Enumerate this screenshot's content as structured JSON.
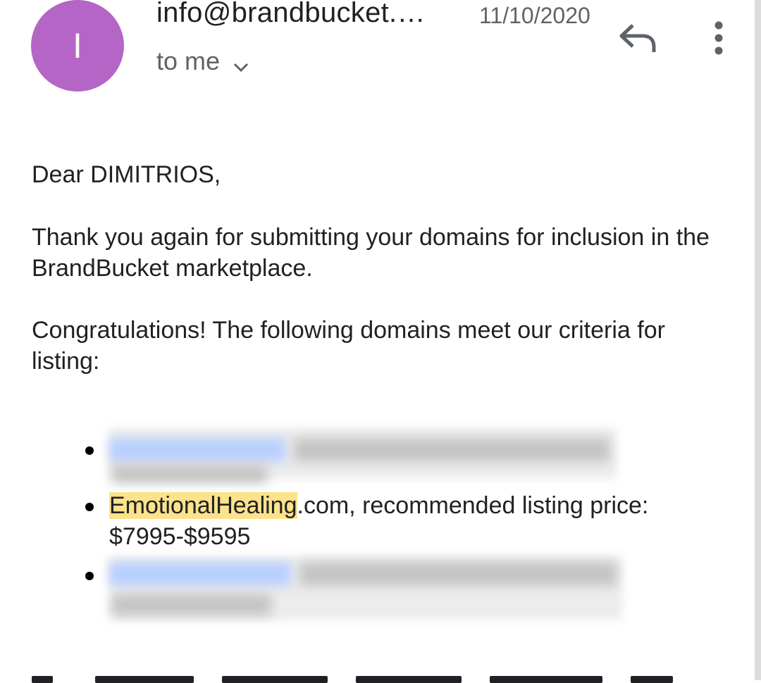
{
  "header": {
    "avatar_letter": "I",
    "sender": "info@brandbucket.…",
    "date": "11/10/2020",
    "recipient": "to me",
    "accent_color": "#b565c6"
  },
  "icons": {
    "reply": "reply-arrow-icon",
    "more": "vertical-dots-icon",
    "expand": "chevron-down-icon"
  },
  "email": {
    "greeting": "Dear DIMITRIOS,",
    "thanks": "Thank you again for submitting your domains for inclusion in the BrandBucket marketplace.",
    "congrats": "Congratulations! The following domains meet our criteria for listing:",
    "items": [
      {
        "redacted": true
      },
      {
        "domain": "EmotionalHealing",
        "rest": ".com, recommended listing price:",
        "price": "$7995-$9595"
      },
      {
        "redacted": true
      }
    ]
  }
}
